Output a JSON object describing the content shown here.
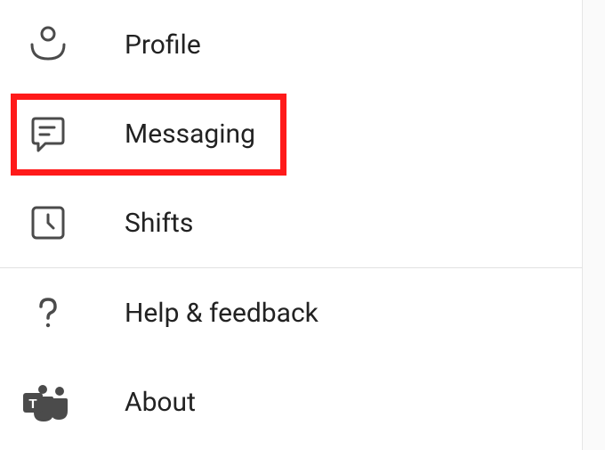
{
  "menu": {
    "items": [
      {
        "id": "profile",
        "label": "Profile",
        "icon": "profile-icon"
      },
      {
        "id": "messaging",
        "label": "Messaging",
        "icon": "chat-icon"
      },
      {
        "id": "shifts",
        "label": "Shifts",
        "icon": "clock-square-icon"
      },
      {
        "id": "help",
        "label": "Help & feedback",
        "icon": "question-icon"
      },
      {
        "id": "about",
        "label": "About",
        "icon": "teams-icon"
      }
    ]
  },
  "highlight": {
    "target": "messaging"
  },
  "iconColor": "#4b4b4b",
  "highlightColor": "#ff1a1a"
}
